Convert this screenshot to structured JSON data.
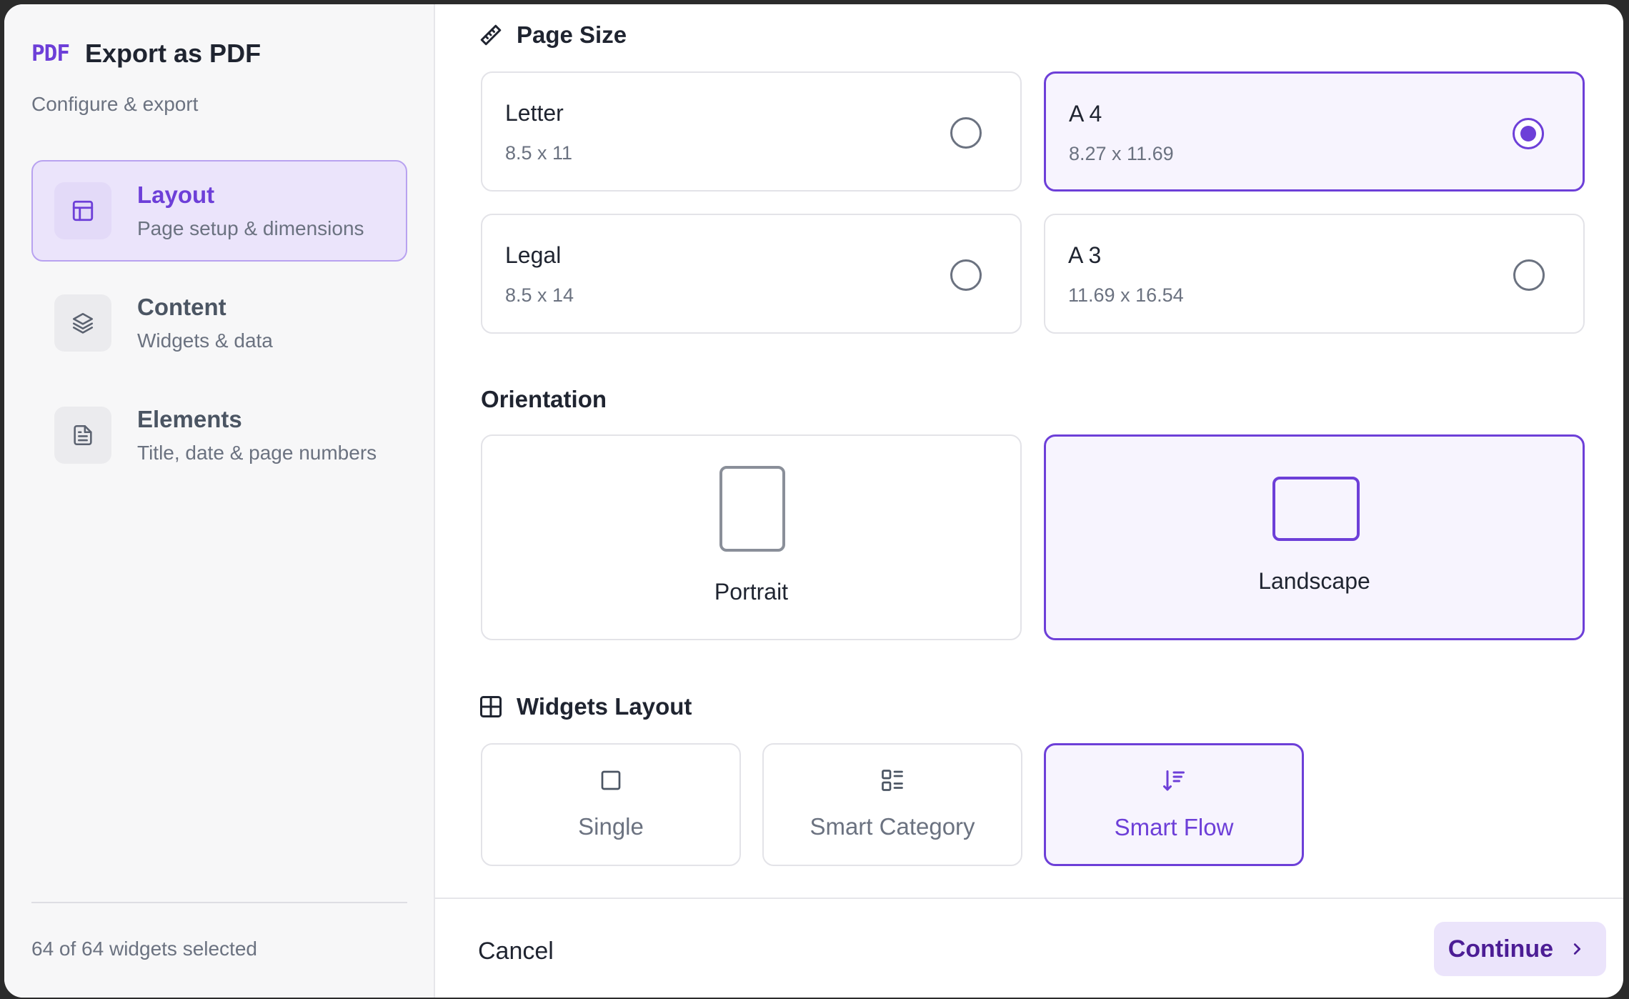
{
  "sidebar": {
    "brand_logo": "PDF",
    "title": "Export as PDF",
    "subtitle": "Configure & export",
    "items": [
      {
        "label": "Layout",
        "desc": "Page setup & dimensions",
        "icon": "layout-icon",
        "active": true
      },
      {
        "label": "Content",
        "desc": "Widgets & data",
        "icon": "layers-icon",
        "active": false
      },
      {
        "label": "Elements",
        "desc": "Title, date & page numbers",
        "icon": "document-icon",
        "active": false
      }
    ],
    "status": "64 of 64 widgets selected"
  },
  "page_size": {
    "title": "Page Size",
    "icon": "ruler-icon",
    "options": [
      {
        "name": "Letter",
        "dims": "8.5 x 11",
        "selected": false
      },
      {
        "name": "A 4",
        "dims": "8.27 x 11.69",
        "selected": true
      },
      {
        "name": "Legal",
        "dims": "8.5 x 14",
        "selected": false
      },
      {
        "name": "A 3",
        "dims": "11.69 x 16.54",
        "selected": false
      }
    ]
  },
  "orientation": {
    "title": "Orientation",
    "options": [
      {
        "label": "Portrait",
        "selected": false
      },
      {
        "label": "Landscape",
        "selected": true
      }
    ]
  },
  "widgets_layout": {
    "title": "Widgets Layout",
    "icon": "grid-icon",
    "options": [
      {
        "label": "Single",
        "icon": "square-icon",
        "selected": false
      },
      {
        "label": "Smart Category",
        "icon": "category-list-icon",
        "selected": false
      },
      {
        "label": "Smart Flow",
        "icon": "sort-flow-icon",
        "selected": true
      }
    ]
  },
  "footer": {
    "cancel_label": "Cancel",
    "continue_label": "Continue"
  },
  "colors": {
    "accent": "#6d3fd8",
    "accent_light": "#ebe4fb",
    "border": "#e3e3e8",
    "muted_text": "#6b7280"
  }
}
